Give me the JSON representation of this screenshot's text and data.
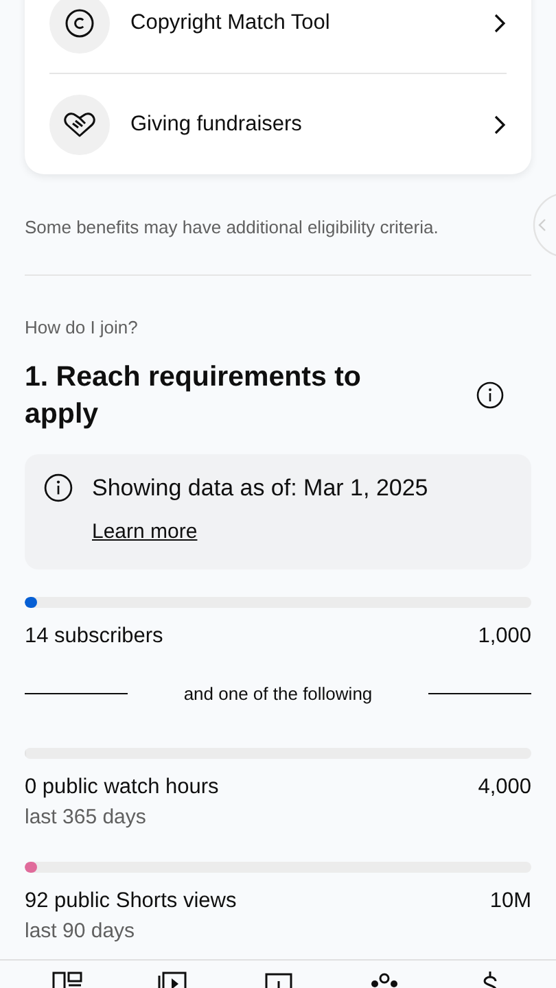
{
  "benefits": [
    {
      "kind": "copyright",
      "label": "Copyright Match Tool"
    },
    {
      "kind": "giving",
      "label": "Giving fundraisers"
    }
  ],
  "benefits_note": "Some benefits may have additional eligibility criteria.",
  "join": {
    "question": "How do I join?",
    "heading": "1. Reach requirements to apply"
  },
  "data_notice": {
    "text": "Showing data as of: Mar 1, 2025",
    "link": "Learn more"
  },
  "metrics": [
    {
      "label": "14 subscribers",
      "target": "1,000",
      "level": 0.014,
      "color": "#065fd4"
    }
  ],
  "separator": "and one of the following",
  "alternatives": [
    {
      "label": "0 public watch hours",
      "sublabel": "last 365 days",
      "target": "4,000",
      "level": 0
    },
    {
      "label": "92 public Shorts views",
      "sublabel": "last 90 days",
      "target": "10M",
      "level": 9.2e-06,
      "color": "#e06b9b"
    }
  ],
  "bottom_nav": [
    {
      "kind": "dashboard"
    },
    {
      "kind": "content"
    },
    {
      "kind": "analytics"
    },
    {
      "kind": "community"
    },
    {
      "kind": "earn"
    }
  ]
}
